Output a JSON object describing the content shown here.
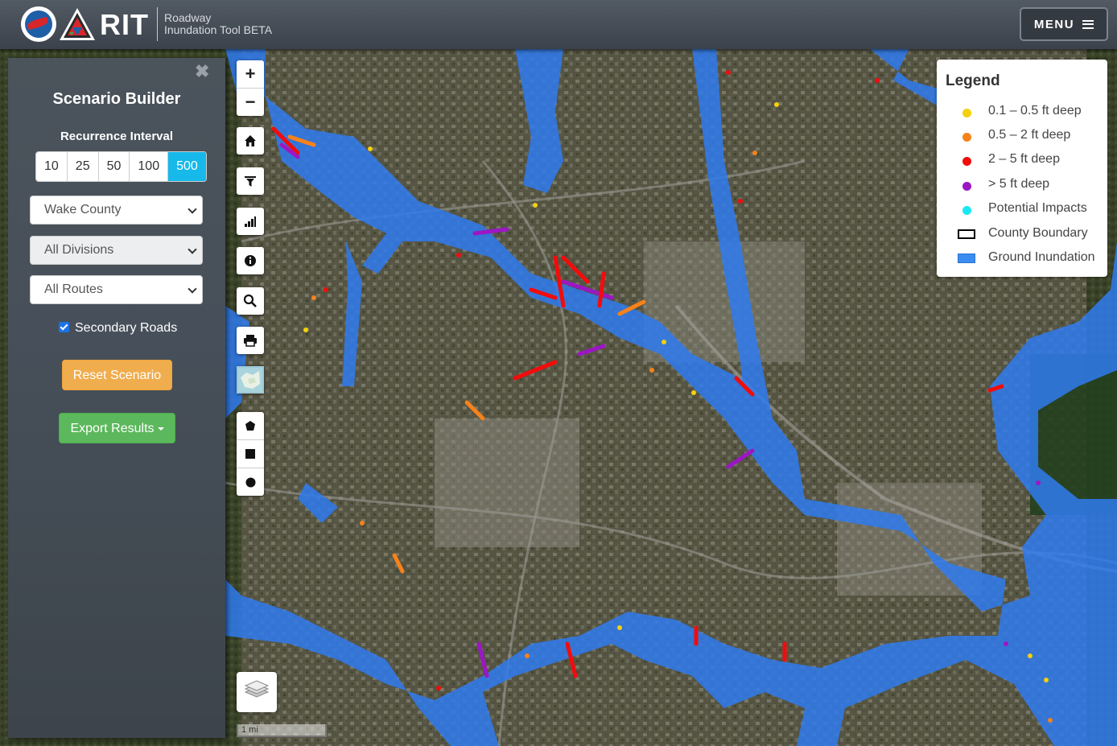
{
  "header": {
    "brand": "RIT",
    "subtitle_line1": "Roadway",
    "subtitle_line2": "Inundation Tool BETA",
    "menu_label": "MENU"
  },
  "scenario": {
    "close": "✖",
    "title": "Scenario Builder",
    "recurrence_label": "Recurrence Interval",
    "intervals": [
      "10",
      "25",
      "50",
      "100",
      "500"
    ],
    "selected_interval": "500",
    "county": "Wake County",
    "division": "All Divisions",
    "routes": "All Routes",
    "secondary_roads_label": "Secondary Roads",
    "secondary_roads_checked": true,
    "reset_label": "Reset Scenario",
    "export_label": "Export Results"
  },
  "map_controls": {
    "zoom_in": "+",
    "zoom_out": "−",
    "scale_label": "1 mi"
  },
  "legend": {
    "title": "Legend",
    "items": [
      {
        "label": "0.1 – 0.5 ft deep",
        "color": "#f4d10b",
        "kind": "dot"
      },
      {
        "label": "0.5 – 2 ft deep",
        "color": "#f7821b",
        "kind": "dot"
      },
      {
        "label": "2 – 5 ft deep",
        "color": "#f20c0c",
        "kind": "dot"
      },
      {
        "label": "> 5 ft deep",
        "color": "#9b17c4",
        "kind": "dot"
      },
      {
        "label": "Potential Impacts",
        "color": "#19e8f2",
        "kind": "dot"
      },
      {
        "label": "County Boundary",
        "color": "#000000",
        "kind": "outline"
      },
      {
        "label": "Ground Inundation",
        "color": "#3a8df0",
        "kind": "fill"
      }
    ]
  },
  "colors": {
    "inundation": "#2f7bef",
    "accent": "#17b8ea",
    "reset": "#f0ad4e",
    "export": "#5cb85c"
  }
}
